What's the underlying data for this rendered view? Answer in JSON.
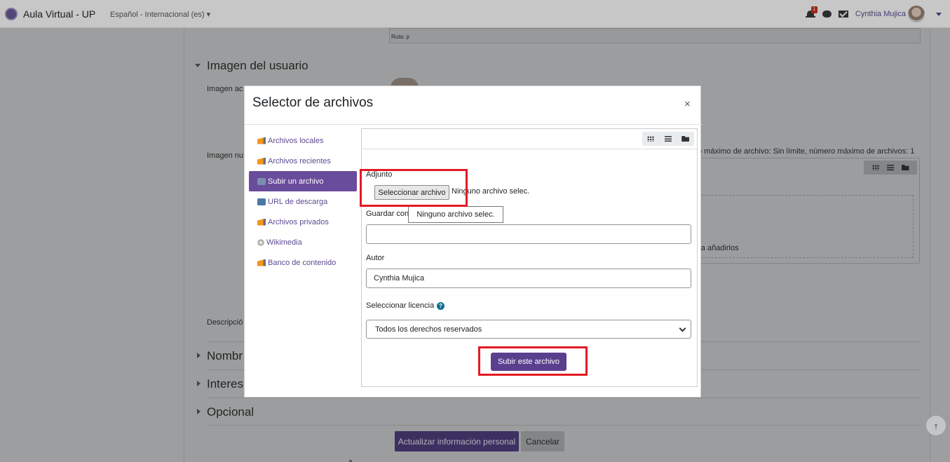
{
  "navbar": {
    "site_name": "Aula Virtual - UP",
    "language": "Español - Internacional (es) ▾",
    "notification_count": "1",
    "user_name": "Cynthia Mujica"
  },
  "background": {
    "ruta": "Ruta: p",
    "section_user_image": "Imagen del usuario",
    "label_current_image": "Imagen ac",
    "label_new_image": "Imagen nu",
    "file_limits": "o máximo de archivo: Sin límite, número máximo de archivos: 1",
    "drop_hint": "ara añadirlos",
    "label_description": "Descripció",
    "section_names": "Nombr",
    "section_interests": "Interes",
    "section_optional": "Opcional",
    "update_button": "Actualizar información personal",
    "cancel_button": "Cancelar"
  },
  "modal": {
    "title": "Selector de archivos",
    "close": "×",
    "repositories": [
      {
        "label": "Archivos locales",
        "icon": "moodle-icon",
        "active": false
      },
      {
        "label": "Archivos recientes",
        "icon": "moodle-icon",
        "active": false
      },
      {
        "label": "Subir un archivo",
        "icon": "upload-icon",
        "active": true
      },
      {
        "label": "URL de descarga",
        "icon": "url-icon",
        "active": false
      },
      {
        "label": "Archivos privados",
        "icon": "moodle-icon",
        "active": false
      },
      {
        "label": "Wikimedia",
        "icon": "wikimedia-icon",
        "active": false
      },
      {
        "label": "Banco de contenido",
        "icon": "moodle-icon",
        "active": false
      }
    ],
    "form": {
      "attachment_label": "Adjunto",
      "choose_button": "Seleccionar archivo",
      "choose_status": "Ninguno archivo selec.",
      "tooltip": "Ninguno archivo selec.",
      "save_as_label": "Guardar con",
      "save_as_value": "",
      "author_label": "Autor",
      "author_value": "Cynthia Mujica",
      "license_label": "Seleccionar licencia",
      "license_value": "Todos los derechos reservados",
      "upload_button": "Subir este archivo"
    }
  },
  "colors": {
    "brand": "#5c4a91",
    "primary_button": "#5a3f8f",
    "highlight": "#e21b24"
  }
}
